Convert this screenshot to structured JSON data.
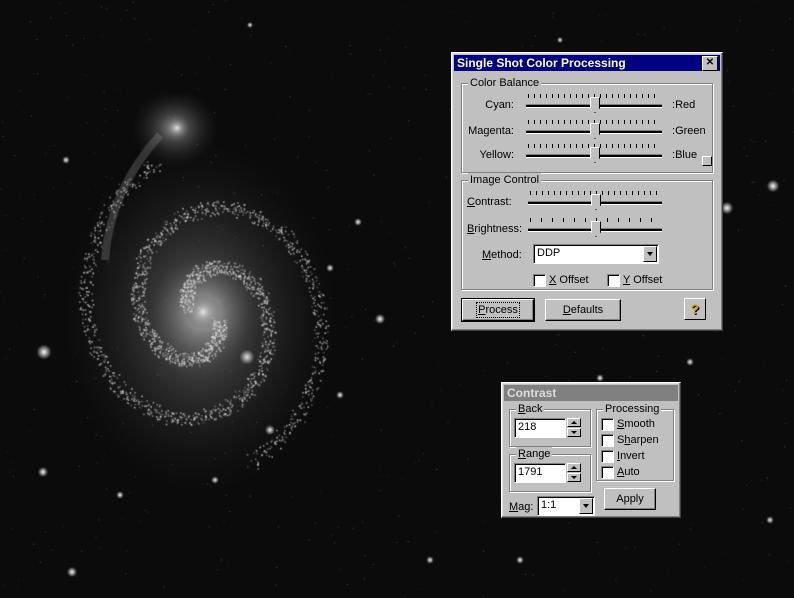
{
  "colors": {
    "title_active": "#000080",
    "title_inactive": "#808080",
    "face": "#c0c0c0",
    "sky": "#0b0b0b"
  },
  "background": {
    "subject": "spiral-galaxy-image"
  },
  "color_dialog": {
    "title": "Single Shot Color Processing",
    "close_icon": "close-icon",
    "color_balance": {
      "label": "Color Balance",
      "sliders": [
        {
          "left": "Cyan:",
          "right": "Red",
          "value": 0.5
        },
        {
          "left": "Magenta:",
          "right": "Green",
          "value": 0.5
        },
        {
          "left": "Yellow:",
          "right": "Blue",
          "value": 0.5
        }
      ]
    },
    "image_control": {
      "label": "Image Control",
      "contrast_label": "Contrast:",
      "contrast_value": 0.5,
      "brightness_label": "Brightness:",
      "brightness_value": 0.5,
      "method_label": "Method:",
      "method_value": "DDP",
      "x_offset_label": "X Offset",
      "y_offset_label": "Y Offset",
      "x_offset_checked": false,
      "y_offset_checked": false
    },
    "process_label": "Process",
    "defaults_label": "Defaults",
    "help_icon": "help-icon"
  },
  "contrast_dialog": {
    "title": "Contrast",
    "back_label": "Back",
    "back_value": "218",
    "range_label": "Range",
    "range_value": "1791",
    "processing_label": "Processing",
    "smooth_label": "Smooth",
    "sharpen_label": "Sharpen",
    "invert_label": "Invert",
    "auto_label": "Auto",
    "mag_label": "Mag:",
    "mag_value": "1:1",
    "apply_label": "Apply"
  }
}
